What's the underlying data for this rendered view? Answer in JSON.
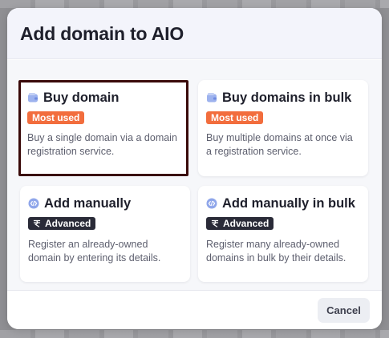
{
  "dialog": {
    "title": "Add domain to AIO",
    "cancel_label": "Cancel"
  },
  "options": [
    {
      "title": "Buy domain",
      "icon": "wallet-icon",
      "badge": "Most used",
      "badge_color": "#f26d3d",
      "description": "Buy a single domain via a domain registration service.",
      "selected": true
    },
    {
      "title": "Buy domains in bulk",
      "icon": "wallet-icon",
      "badge": "Most used",
      "badge_color": "#f26d3d",
      "description": "Buy multiple domains at once via a registration service.",
      "selected": false
    },
    {
      "title": "Add manually",
      "icon": "code-icon",
      "badge": "Advanced",
      "badge_color": "#2a2b38",
      "description": "Register an already-owned domain by entering its details.",
      "selected": false
    },
    {
      "title": "Add manually in bulk",
      "icon": "code-icon",
      "badge": "Advanced",
      "badge_color": "#2a2b38",
      "description": "Register many already-owned domains in bulk by their details.",
      "selected": false
    }
  ],
  "colors": {
    "accent_orange": "#f26d3d",
    "icon_blue": "#8fa6ea",
    "selection_border": "#3a0a0a"
  }
}
